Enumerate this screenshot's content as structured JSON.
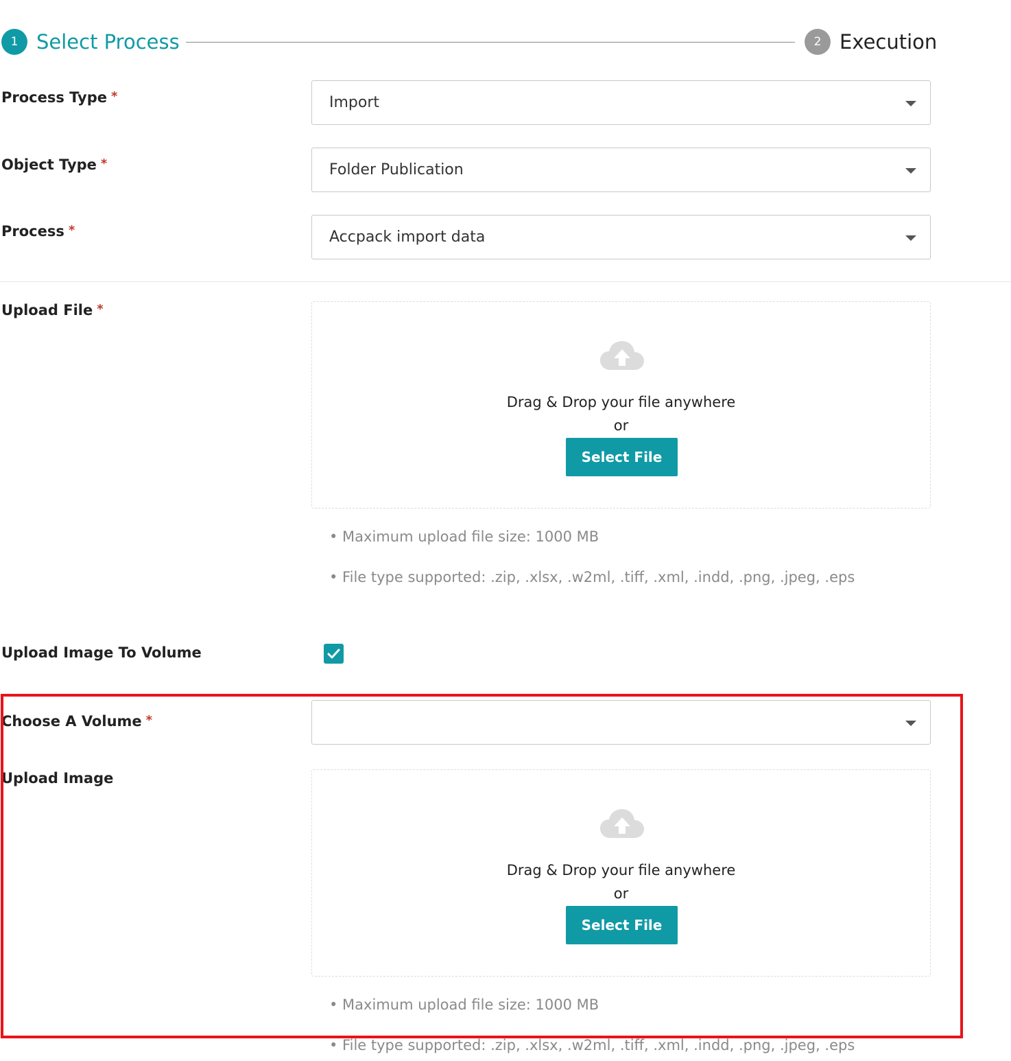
{
  "stepper": {
    "steps": [
      {
        "number": "1",
        "label": "Select Process"
      },
      {
        "number": "2",
        "label": "Execution"
      }
    ]
  },
  "form": {
    "required_marker": "*",
    "process_type": {
      "label": "Process Type",
      "value": "Import"
    },
    "object_type": {
      "label": "Object Type",
      "value": "Folder Publication"
    },
    "process": {
      "label": "Process",
      "value": "Accpack import data"
    },
    "upload_file": {
      "label": "Upload File",
      "drop_text": "Drag & Drop your file anywhere",
      "or_text": "or",
      "button_label": "Select File",
      "note_max_size": "• Maximum upload file size: 1000 MB",
      "note_file_types": "• File type supported: .zip, .xlsx, .w2ml, .tiff, .xml, .indd, .png, .jpeg, .eps"
    },
    "upload_image_to_volume": {
      "label": "Upload Image To Volume",
      "checked": true
    },
    "choose_volume": {
      "label": "Choose A Volume",
      "value": ""
    },
    "upload_image": {
      "label": "Upload Image",
      "drop_text": "Drag & Drop your file anywhere",
      "or_text": "or",
      "button_label": "Select File",
      "note_max_size": "• Maximum upload file size: 1000 MB",
      "note_file_types": "• File type supported: .zip, .xlsx, .w2ml, .tiff, .xml, .indd, .png, .jpeg, .eps"
    }
  },
  "colors": {
    "accent": "#109aa5",
    "highlight": "#e8141a",
    "required": "#c0392b",
    "step_inactive": "#9a9a9a"
  },
  "icons": [
    "cloud-upload-icon",
    "chevron-down-icon",
    "checkmark-icon"
  ]
}
